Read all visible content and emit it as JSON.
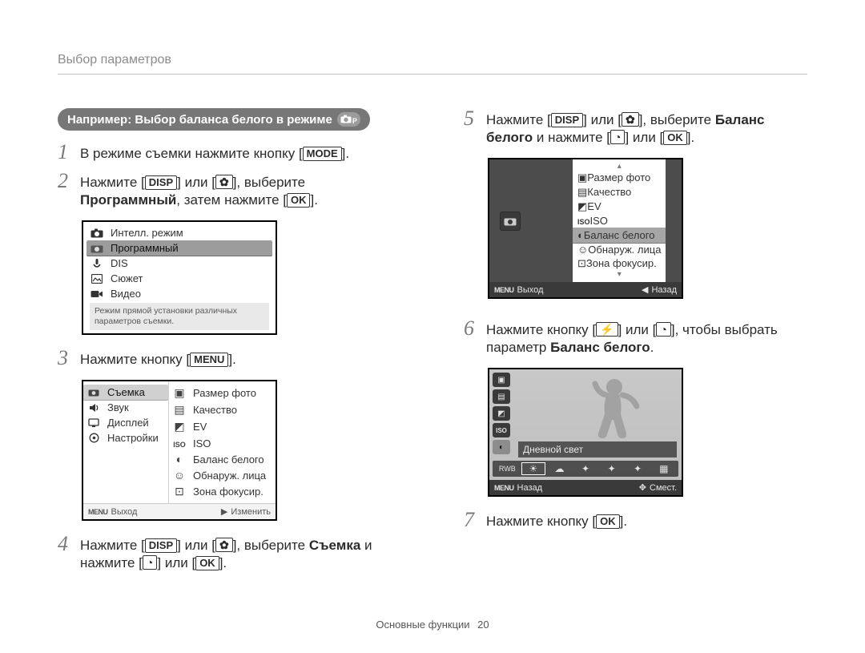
{
  "header": {
    "title": "Выбор параметров"
  },
  "pill": {
    "text": "Например: Выбор баланса белого в режиме",
    "mode_sub": "P"
  },
  "keys": {
    "mode": "MODE",
    "disp": "DISP",
    "menu_label": "MENU",
    "ok": "OK"
  },
  "steps": {
    "s1": {
      "num": "1",
      "pre": "В режиме съемки нажмите кнопку [",
      "post": "]."
    },
    "s2": {
      "num": "2",
      "a": "Нажмите [",
      "b": "] или [",
      "c": "], выберите ",
      "bold": "Программный",
      "d": ", затем нажмите [",
      "e": "]."
    },
    "s3": {
      "num": "3",
      "a": "Нажмите кнопку [",
      "b": "]."
    },
    "s4": {
      "num": "4",
      "a": "Нажмите [",
      "b": "] или [",
      "c": "], выберите ",
      "bold": "Съемка",
      "d": " и нажмите [",
      "e": "] или [",
      "f": "]."
    },
    "s5": {
      "num": "5",
      "a": "Нажмите [",
      "b": "] или [",
      "c": "], выберите ",
      "bold": "Баланс белого",
      "d": " и нажмите [",
      "e": "] или [",
      "f": "]."
    },
    "s6": {
      "num": "6",
      "a": "Нажмите кнопку [",
      "b": "] или [",
      "c": "], чтобы выбрать параметр ",
      "bold": "Баланс белого",
      "d": "."
    },
    "s7": {
      "num": "7",
      "a": "Нажмите кнопку [",
      "b": "]."
    }
  },
  "panel_modes": {
    "items": [
      {
        "icon": "camera",
        "label": "Интелл. режим"
      },
      {
        "icon": "mode-p",
        "label": "Программный"
      },
      {
        "icon": "dis",
        "label": "DIS"
      },
      {
        "icon": "scene",
        "label": "Сюжет"
      },
      {
        "icon": "video",
        "label": "Видео"
      }
    ],
    "selected": 1,
    "desc": "Режим прямой установки различных параметров съемки."
  },
  "panel_menu": {
    "left": [
      {
        "icon": "camera",
        "label": "Съемка"
      },
      {
        "icon": "sound",
        "label": "Звук"
      },
      {
        "icon": "display",
        "label": "Дисплей"
      },
      {
        "icon": "gear",
        "label": "Настройки"
      }
    ],
    "left_selected": 0,
    "right": [
      {
        "icon": "size",
        "label": "Размер фото"
      },
      {
        "icon": "quality",
        "label": "Качество"
      },
      {
        "icon": "ev",
        "label": "EV"
      },
      {
        "icon": "iso",
        "label": "ISO"
      },
      {
        "icon": "wb",
        "label": "Баланс белого"
      },
      {
        "icon": "face",
        "label": "Обнаруж. лица"
      },
      {
        "icon": "focus",
        "label": "Зона фокусир."
      }
    ],
    "foot": {
      "left_key": "MENU",
      "left": "Выход",
      "right_sym": "▶",
      "right": "Изменить"
    }
  },
  "panel_wblist": {
    "items": [
      {
        "icon": "size",
        "label": "Размер фото"
      },
      {
        "icon": "quality",
        "label": "Качество"
      },
      {
        "icon": "ev",
        "label": "EV"
      },
      {
        "icon": "iso",
        "label": "ISO"
      },
      {
        "icon": "wb",
        "label": "Баланс белого"
      },
      {
        "icon": "face",
        "label": "Обнаруж. лица"
      },
      {
        "icon": "focus",
        "label": "Зона фокусир."
      }
    ],
    "selected": 4,
    "foot": {
      "left_key": "MENU",
      "left": "Выход",
      "right_sym": "◀",
      "right": "Назад"
    }
  },
  "panel_preview": {
    "wb_label": "Дневной свет",
    "rail_icons": [
      "size",
      "quality",
      "ev",
      "iso",
      "wb"
    ],
    "rail_selected": 4,
    "strip": [
      "AWB",
      "☀",
      "☁",
      "✦",
      "✦",
      "✦",
      "▦"
    ],
    "strip_selected": 1,
    "foot": {
      "left_key": "MENU",
      "left": "Назад",
      "right_sym": "✥",
      "right": "Смест."
    }
  },
  "footer": {
    "section": "Основные функции",
    "page": "20"
  }
}
